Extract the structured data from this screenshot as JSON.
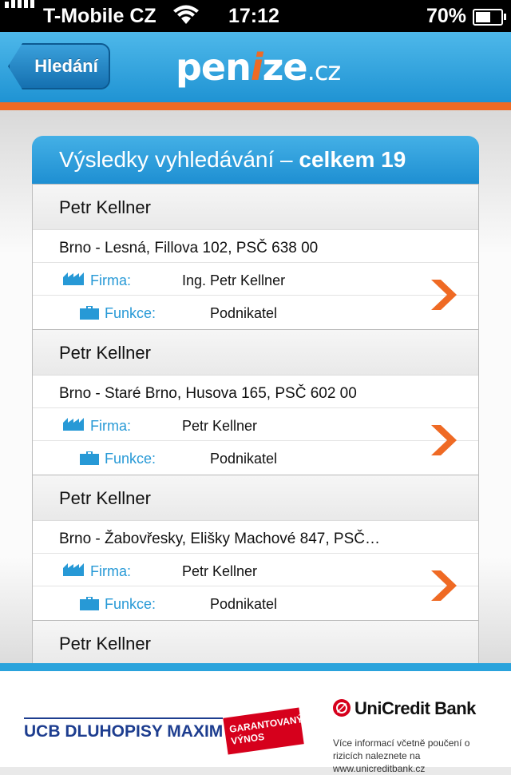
{
  "status_bar": {
    "carrier": "T-Mobile CZ",
    "time": "17:12",
    "battery": "70%",
    "battery_level": 0.7
  },
  "nav": {
    "back_label": "Hledání",
    "logo_part1": "pen",
    "logo_part2": "i",
    "logo_part3": "ze",
    "logo_part4": ".cz"
  },
  "results": {
    "title": "Výsledky vyhledávání –",
    "count_label": "celkem 19",
    "firma_label": "Firma:",
    "funkce_label": "Funkce:",
    "items": [
      {
        "name": "Petr Kellner",
        "address": "Brno - Lesná, Fillova 102, PSČ 638 00",
        "firma": "Ing. Petr Kellner",
        "funkce": "Podnikatel"
      },
      {
        "name": "Petr Kellner",
        "address": "Brno - Staré Brno, Husova 165, PSČ 602 00",
        "firma": "Petr Kellner",
        "funkce": "Podnikatel"
      },
      {
        "name": "Petr Kellner",
        "address": "Brno - Žabovřesky, Elišky Machové 847, PSČ…",
        "firma": "Petr Kellner",
        "funkce": "Podnikatel"
      },
      {
        "name": "Petr Kellner"
      }
    ]
  },
  "ad": {
    "product": "UCB DLUHOPISY MAXIM",
    "badge_line1": "GARANTOVANÝ",
    "badge_line2": "VÝNOS",
    "bank_name": "UniCredit Bank",
    "info": "Více informací včetně poučení o rizicích naleznete na www.unicreditbank.cz"
  },
  "colors": {
    "nav_blue": "#2a9bd8",
    "accent_orange": "#ef6a24",
    "label_blue": "#2799d6"
  }
}
